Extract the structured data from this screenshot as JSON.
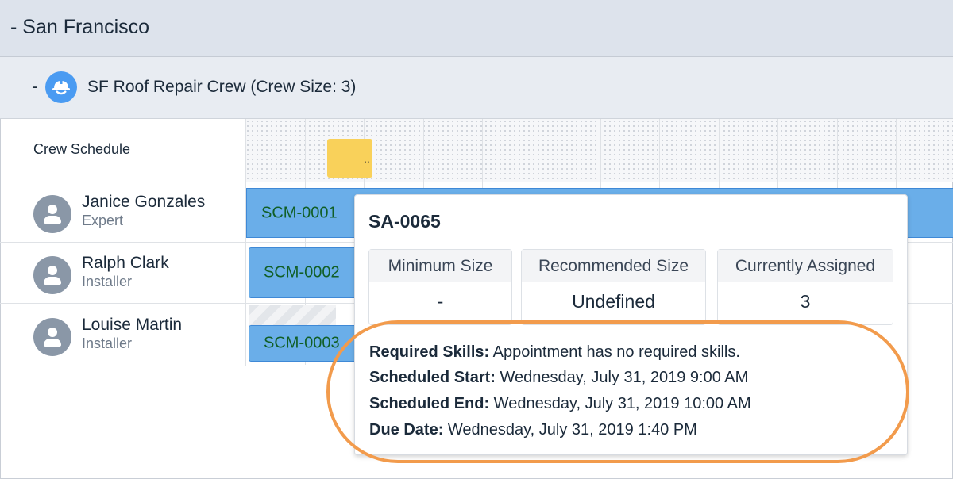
{
  "region": {
    "collapse": "-",
    "name": "San Francisco"
  },
  "crew": {
    "collapse": "-",
    "icon": "hard-hat-icon",
    "title": "SF Roof Repair Crew (Crew Size: 3)"
  },
  "crew_schedule": {
    "label": "Crew Schedule",
    "block_text": ".."
  },
  "members": [
    {
      "name": "Janice Gonzales",
      "role": "Expert",
      "bar": "SCM-0001"
    },
    {
      "name": "Ralph Clark",
      "role": "Installer",
      "bar": "SCM-0002"
    },
    {
      "name": "Louise Martin",
      "role": "Installer",
      "bar": "SCM-0003"
    }
  ],
  "popover": {
    "title": "SA-0065",
    "metrics": [
      {
        "label": "Minimum Size",
        "value": "-"
      },
      {
        "label": "Recommended Size",
        "value": "Undefined"
      },
      {
        "label": "Currently Assigned",
        "value": "3"
      }
    ],
    "details": [
      {
        "label": "Required Skills:",
        "value": " Appointment has no required skills."
      },
      {
        "label": "Scheduled Start:",
        "value": " Wednesday, July 31, 2019 9:00 AM"
      },
      {
        "label": "Scheduled End:",
        "value": " Wednesday, July 31, 2019 10:00 AM"
      },
      {
        "label": "Due Date:",
        "value": " Wednesday, July 31, 2019 1:40 PM"
      }
    ]
  },
  "colors": {
    "bar_fill": "#6aaee9",
    "bar_text": "#115f26",
    "highlight": "#f29b4c",
    "crew_icon": "#4a9bf2",
    "yellow_block": "#f9d15a"
  }
}
